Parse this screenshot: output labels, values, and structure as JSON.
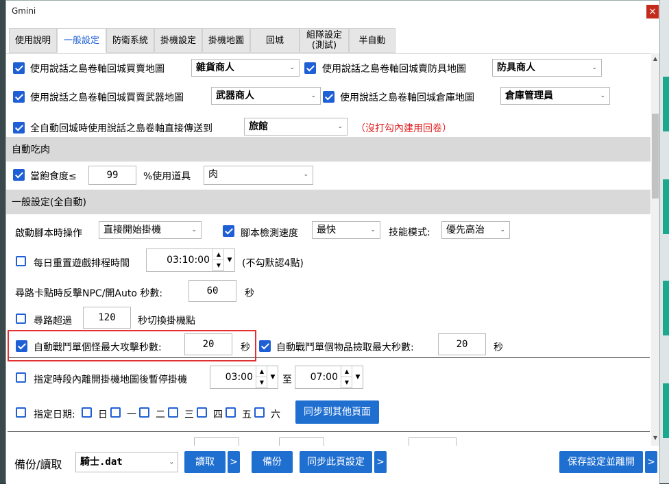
{
  "window": {
    "title": "Gmini",
    "close": "×"
  },
  "tabs": [
    {
      "label": "使用說明"
    },
    {
      "label": "一般設定"
    },
    {
      "label": "防衛系統"
    },
    {
      "label": "掛機設定"
    },
    {
      "label": "掛機地圖"
    },
    {
      "label": "回城"
    },
    {
      "label": "組隊設定\n(測試)"
    },
    {
      "label": "半自動"
    }
  ],
  "rows": {
    "r1a": "使用說話之島卷軸回城買賣地圖",
    "r1a_val": "雜貨商人",
    "r1b": "使用說話之島卷軸回城賣防具地圖",
    "r1b_val": "防具商人",
    "r2a": "使用說話之島卷軸回城買賣武器地圖",
    "r2a_val": "武器商人",
    "r2b": "使用說話之島卷軸回城倉庫地圖",
    "r2b_val": "倉庫管理員",
    "r3": "全自動回城時使用說話之島卷軸直接傳送到",
    "r3_val": "旅館",
    "r3_note": "（沒打勾內建用回卷）"
  },
  "section_eat": {
    "title": "自動吃肉",
    "label": "當飽食度≤",
    "value": "99",
    "label2": "%使用道具",
    "item": "肉"
  },
  "section_general": {
    "title": "一般設定(全自動)"
  },
  "general": {
    "start_label": "啟動腳本時操作",
    "start_val": "直接開始掛機",
    "speed_label": "腳本檢測速度",
    "speed_val": "最快",
    "skill_label": "技能模式:",
    "skill_val": "優先高治",
    "reset_label": "每日重置遊戲排程時間",
    "reset_time": "03:10:00",
    "reset_note": "(不勾默認4點)",
    "stuck_label": "尋路卡點時反擊NPC/開Auto 秒數:",
    "stuck_val": "60",
    "sec": "秒",
    "path_label": "尋路超過",
    "path_val": "120",
    "path_suffix": "秒切換掛機點",
    "attack_label": "自動戰鬥單個怪最大攻擊秒數:",
    "attack_val": "20",
    "pickup_label": "自動戰鬥單個物品撿取最大秒數:",
    "pickup_val": "20",
    "period_label": "指定時段內離開掛機地圖後暫停掛機",
    "period_from": "03:00",
    "period_to_label": "至",
    "period_to": "07:00",
    "date_label": "指定日期:",
    "days": [
      "日",
      "一",
      "二",
      "三",
      "四",
      "五",
      "六"
    ],
    "sync_btn": "同步到其他頁面"
  },
  "footer": {
    "backup_label": "備份/讀取",
    "file": "騎士.dat",
    "load": "讀取",
    "more": ">",
    "backup": "備份",
    "sync_page": "同步此頁設定",
    "save_exit": "保存設定並離開"
  },
  "colors": {
    "accent": "#1f5fd6",
    "button": "#1f6fd0",
    "note": "#e02020",
    "highlight": "#e03030"
  }
}
